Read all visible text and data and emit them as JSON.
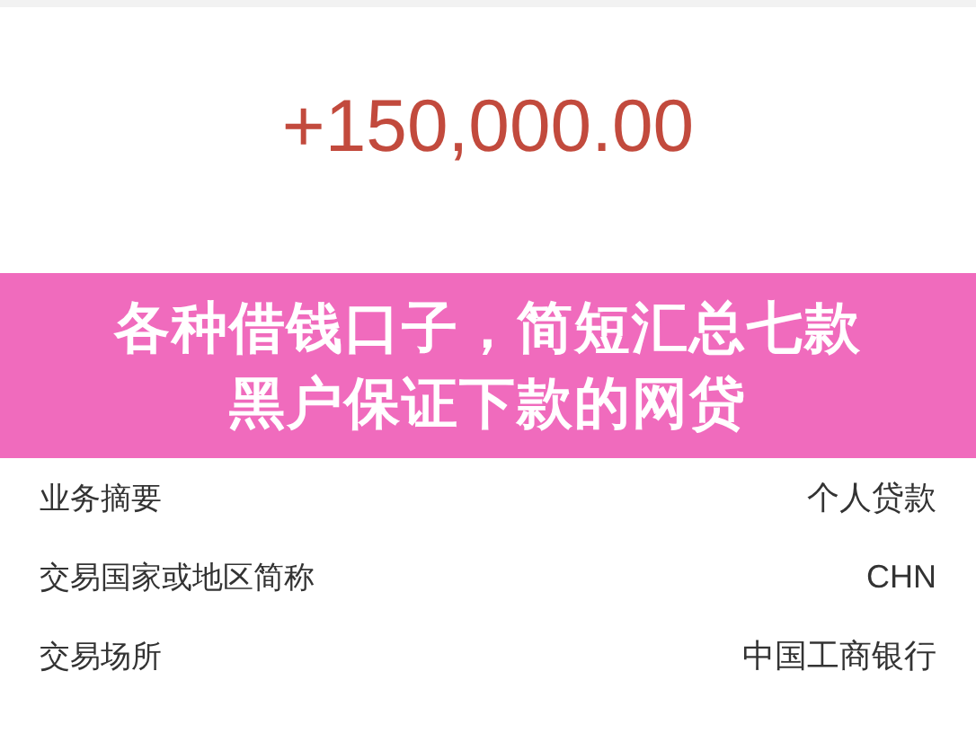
{
  "amount": "+150,000.00",
  "banner": {
    "lines": [
      "各种借钱口子，简短汇总七款",
      "黑户保证下款的网贷"
    ]
  },
  "rows": [
    {
      "label": "业务摘要",
      "value": "个人贷款"
    },
    {
      "label": "交易国家或地区简称",
      "value": "CHN"
    },
    {
      "label": "交易场所",
      "value": "中国工商银行"
    }
  ]
}
